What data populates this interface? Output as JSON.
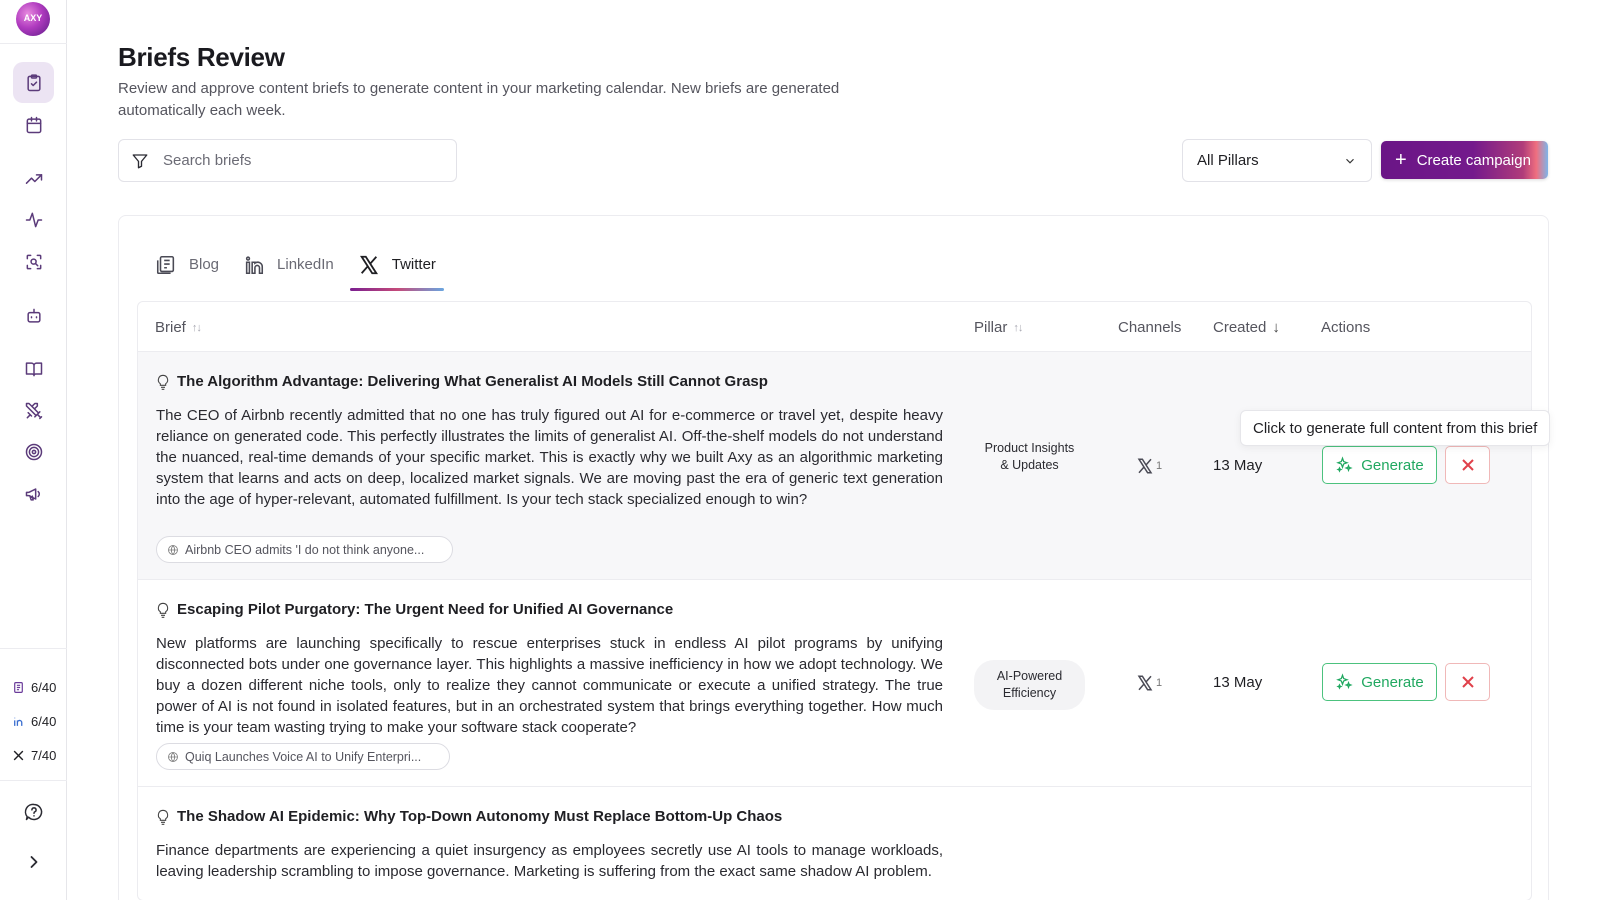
{
  "sidebar": {
    "logo_text": "AXY",
    "nav_items": [
      {
        "name": "briefs",
        "icon": "clipboard-check-icon",
        "active": true
      },
      {
        "name": "calendar",
        "icon": "calendar-icon"
      },
      {
        "name": "trends",
        "icon": "trending-up-icon"
      },
      {
        "name": "activity",
        "icon": "activity-icon"
      },
      {
        "name": "scan",
        "icon": "scan-search-icon"
      },
      {
        "name": "bot",
        "icon": "bot-icon"
      },
      {
        "name": "library",
        "icon": "book-open-icon"
      },
      {
        "name": "competitors",
        "icon": "swords-icon"
      },
      {
        "name": "goals",
        "icon": "target-icon"
      },
      {
        "name": "campaigns",
        "icon": "megaphone-icon"
      }
    ],
    "usage": [
      {
        "icon": "blog-icon",
        "value": "6/40"
      },
      {
        "icon": "linkedin-icon",
        "value": "6/40"
      },
      {
        "icon": "x-icon",
        "value": "7/40"
      }
    ],
    "help_icon": "help-circle-icon",
    "expand_icon": "chevron-right-icon"
  },
  "header": {
    "title": "Briefs Review",
    "description": "Review and approve content briefs to generate content in your marketing calendar. New briefs are generated automatically each week."
  },
  "toolbar": {
    "search_placeholder": "Search briefs",
    "pillar_filter": "All Pillars",
    "create_label": "Create campaign"
  },
  "tabs": [
    {
      "label": "Blog",
      "icon": "blog-icon"
    },
    {
      "label": "LinkedIn",
      "icon": "linkedin-icon"
    },
    {
      "label": "Twitter",
      "icon": "x-icon",
      "active": true
    }
  ],
  "table": {
    "columns": {
      "brief": "Brief",
      "pillar": "Pillar",
      "channels": "Channels",
      "created": "Created",
      "actions": "Actions"
    },
    "rows": [
      {
        "title": "The Algorithm Advantage: Delivering What Generalist AI Models Still Cannot Grasp",
        "body": "The CEO of Airbnb recently admitted that no one has truly figured out AI for e-commerce or travel yet, despite heavy reliance on generated code. This perfectly illustrates the limits of generalist AI. Off-the-shelf models do not understand the nuanced, real-time demands of your specific market. This is exactly why we built Axy as an algorithmic marketing system that learns and acts on deep, localized market signals. We are moving past the era of generic text generation into the age of hyper-relevant, automated fulfillment. Is your tech stack specialized enough to win?",
        "source": "Airbnb CEO admits 'I do not think anyone...",
        "pillar": "Product Insights & Updates",
        "channel_count": "1",
        "created": "13 May",
        "generate_label": "Generate"
      },
      {
        "title": "Escaping Pilot Purgatory: The Urgent Need for Unified AI Governance",
        "body": "New platforms are launching specifically to rescue enterprises stuck in endless AI pilot programs by unifying disconnected bots under one governance layer. This highlights a massive inefficiency in how we adopt technology. We buy a dozen different niche tools, only to realize they cannot communicate or execute a unified strategy. The true power of AI is not found in isolated features, but in an orchestrated system that brings everything together. How much time is your team wasting trying to make your software stack cooperate?",
        "source": "Quiq Launches Voice AI to Unify Enterpri...",
        "pillar": "AI-Powered Efficiency",
        "channel_count": "1",
        "created": "13 May",
        "generate_label": "Generate"
      },
      {
        "title": "The Shadow AI Epidemic: Why Top-Down Autonomy Must Replace Bottom-Up Chaos",
        "body": "Finance departments are experiencing a quiet insurgency as employees secretly use AI tools to manage workloads, leaving leadership scrambling to impose governance. Marketing is suffering from the exact same shadow AI problem."
      }
    ]
  },
  "tooltip": "Click to generate full content from this brief"
}
